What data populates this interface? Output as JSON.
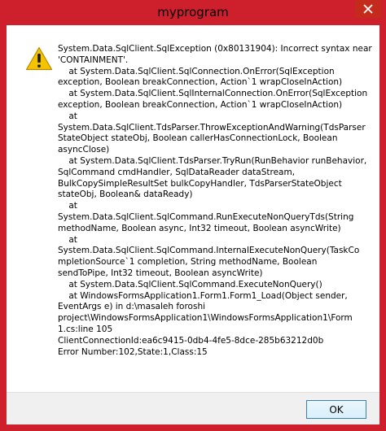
{
  "window": {
    "title": "myprogram",
    "accent_color": "#ce1f2d"
  },
  "message": {
    "icon": "warning-icon",
    "text": "System.Data.SqlClient.SqlException (0x80131904): Incorrect syntax near\n'CONTAINMENT'.\n    at System.Data.SqlClient.SqlConnection.OnError(SqlException\nexception, Boolean breakConnection, Action`1 wrapCloseInAction)\n    at System.Data.SqlClient.SqlInternalConnection.OnError(SqlException\nexception, Boolean breakConnection, Action`1 wrapCloseInAction)\n    at\nSystem.Data.SqlClient.TdsParser.ThrowExceptionAndWarning(TdsParser\nStateObject stateObj, Boolean callerHasConnectionLock, Boolean\nasyncClose)\n    at System.Data.SqlClient.TdsParser.TryRun(RunBehavior runBehavior,\nSqlCommand cmdHandler, SqlDataReader dataStream,\nBulkCopySimpleResultSet bulkCopyHandler, TdsParserStateObject\nstateObj, Boolean& dataReady)\n    at\nSystem.Data.SqlClient.SqlCommand.RunExecuteNonQueryTds(String\nmethodName, Boolean async, Int32 timeout, Boolean asyncWrite)\n    at\nSystem.Data.SqlClient.SqlCommand.InternalExecuteNonQuery(TaskCo\nmpletionSource`1 completion, String methodName, Boolean\nsendToPipe, Int32 timeout, Boolean asyncWrite)\n    at System.Data.SqlClient.SqlCommand.ExecuteNonQuery()\n    at WindowsFormsApplication1.Form1.Form1_Load(Object sender,\nEventArgs e) in d:\\masaleh foroshi\nproject\\WindowsFormsApplication1\\WindowsFormsApplication1\\Form\n1.cs:line 105\nClientConnectionId:ea6c9415-0db4-4fe5-8dce-285b63212d0b\nError Number:102,State:1,Class:15"
  },
  "buttons": {
    "ok_label": "OK"
  }
}
